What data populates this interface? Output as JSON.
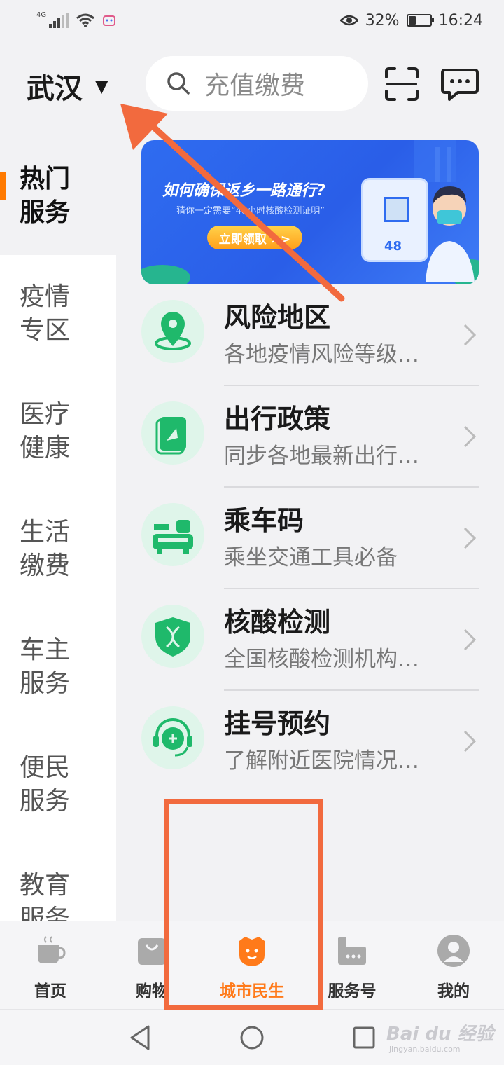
{
  "status_bar": {
    "network_tag": "4G",
    "battery_percent": "32%",
    "battery_level": 0.32,
    "time": "16:24"
  },
  "header": {
    "city": "武汉",
    "search_placeholder": "充值缴费",
    "icons": [
      "scan-icon",
      "message-icon"
    ]
  },
  "sidebar": {
    "items": [
      {
        "label": "热门服务",
        "active": true
      },
      {
        "label": "疫情专区",
        "active": false
      },
      {
        "label": "医疗健康",
        "active": false
      },
      {
        "label": "生活缴费",
        "active": false
      },
      {
        "label": "车主服务",
        "active": false
      },
      {
        "label": "便民服务",
        "active": false
      },
      {
        "label": "教育服务",
        "active": false
      }
    ]
  },
  "banner": {
    "title": "如何确保返乡一路通行?",
    "subtitle": "猜你一定需要“48小时核酸检测证明”",
    "button": "立即领取 >>",
    "card_number": "48"
  },
  "services": [
    {
      "title": "风险地区",
      "subtitle": "各地疫情风险等级…",
      "icon": "location-pin-icon"
    },
    {
      "title": "出行政策",
      "subtitle": "同步各地最新出行…",
      "icon": "travel-policy-icon"
    },
    {
      "title": "乘车码",
      "subtitle": "乘坐交通工具必备",
      "icon": "bus-icon"
    },
    {
      "title": "核酸检测",
      "subtitle": "全国核酸检测机构…",
      "icon": "dna-shield-icon"
    },
    {
      "title": "挂号预约",
      "subtitle": "了解附近医院情况…",
      "icon": "headset-medical-icon"
    }
  ],
  "tabbar": {
    "tabs": [
      {
        "label": "首页",
        "icon": "coffee-cup-icon"
      },
      {
        "label": "购物",
        "icon": "shopping-bag-icon"
      },
      {
        "label": "城市民生",
        "icon": "city-mascot-icon",
        "active": true
      },
      {
        "label": "服务号",
        "icon": "service-account-icon"
      },
      {
        "label": "我的",
        "icon": "profile-icon"
      }
    ]
  },
  "colors": {
    "accent": "#ff7a1a",
    "annotation": "#f26a3e",
    "service_green": "#1fb96b",
    "service_green_bg": "#dff5ea",
    "banner_blue": "#2f6cf0"
  },
  "watermark": {
    "text": "Bai du 经验",
    "sub": "jingyan.baidu.com"
  }
}
